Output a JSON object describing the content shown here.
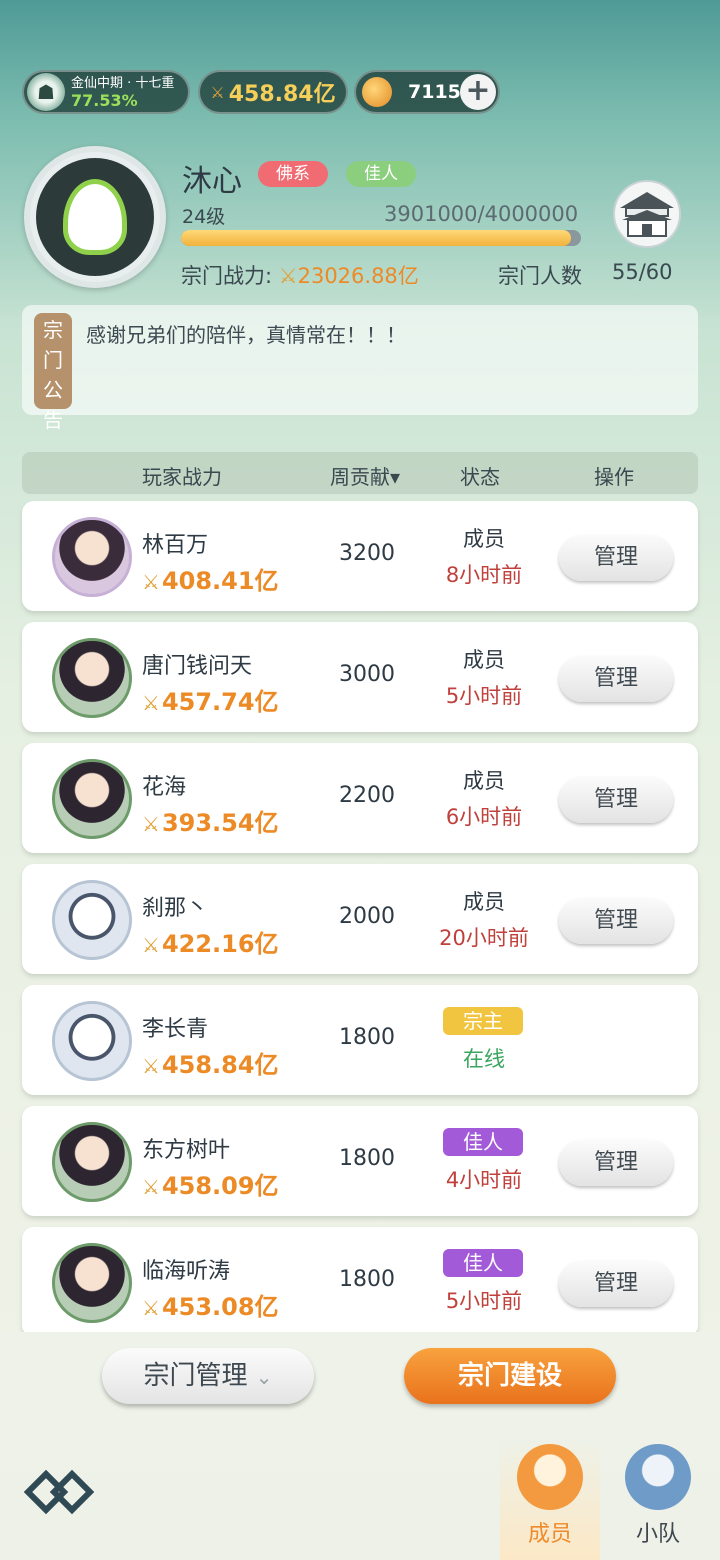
{
  "top_bar": {
    "realm_name": "金仙中期 · 十七重",
    "realm_progress": "77.53%",
    "player_power": "458.84亿",
    "currency": "7115",
    "add_label": "+"
  },
  "sect": {
    "name": "沐心",
    "tags": [
      "佛系",
      "佳人"
    ],
    "level": "24级",
    "exp": "3901000/4000000",
    "exp_fraction": 0.975,
    "power_label": "宗门战力:",
    "power_value": "23026.88亿",
    "members_label": "宗门人数",
    "members_value": "55/60"
  },
  "notice": {
    "label": "宗门公告",
    "message": "感谢兄弟们的陪伴，真情常在！！！"
  },
  "table": {
    "headers": [
      "玩家战力",
      "周贡献▾",
      "状态",
      "操作"
    ],
    "rows": [
      {
        "name": "林百万",
        "power": "408.41亿",
        "contribution": "3200",
        "role": "成员",
        "time": "8小时前",
        "action": "管理"
      },
      {
        "name": "唐门钱问天",
        "power": "457.74亿",
        "contribution": "3000",
        "role": "成员",
        "time": "5小时前",
        "action": "管理"
      },
      {
        "name": "花海",
        "power": "393.54亿",
        "contribution": "2200",
        "role": "成员",
        "time": "6小时前",
        "action": "管理"
      },
      {
        "name": "刹那丶",
        "power": "422.16亿",
        "contribution": "2000",
        "role": "成员",
        "time": "20小时前",
        "action": "管理"
      },
      {
        "name": "李长青",
        "power": "458.84亿",
        "contribution": "1800",
        "role": "宗主",
        "time": "在线",
        "action": ""
      },
      {
        "name": "东方树叶",
        "power": "458.09亿",
        "contribution": "1800",
        "role": "佳人",
        "time": "4小时前",
        "action": "管理"
      },
      {
        "name": "临海听涛",
        "power": "453.08亿",
        "contribution": "1800",
        "role": "佳人",
        "time": "5小时前",
        "action": "管理"
      }
    ]
  },
  "buttons": {
    "manage_sect": "宗门管理",
    "build_sect": "宗门建设"
  },
  "tabs": {
    "members": "成员",
    "team": "小队"
  },
  "colors": {
    "accent_orange": "#ec8a26",
    "leader_badge": "#f1c53f",
    "beauty_badge": "#a35ad8",
    "offline_time": "#c0403c",
    "online_time": "#3aa55e"
  }
}
